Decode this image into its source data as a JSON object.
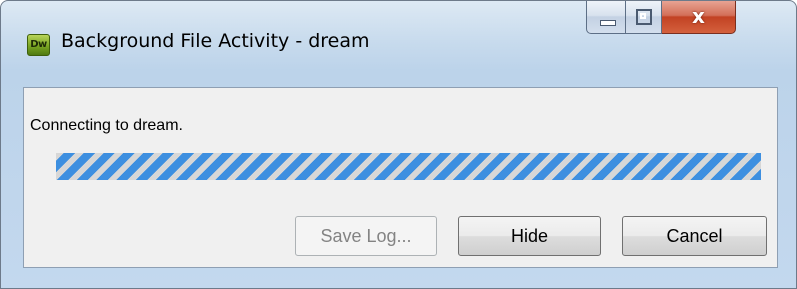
{
  "window": {
    "title": "Background File Activity - dream",
    "app_icon_label": "Dw",
    "app_icon_name": "dreamweaver-app-icon",
    "caption": {
      "minimize_icon": "minimize-icon",
      "maximize_icon": "maximize-icon",
      "close_icon": "close-icon",
      "close_glyph": "x"
    }
  },
  "status": {
    "message": "Connecting to dream."
  },
  "progress": {
    "mode": "indeterminate",
    "colors": [
      "#3d8fe0",
      "#d7d7d7"
    ]
  },
  "buttons": {
    "save_log": "Save Log...",
    "save_log_enabled": false,
    "hide": "Hide",
    "cancel": "Cancel"
  }
}
